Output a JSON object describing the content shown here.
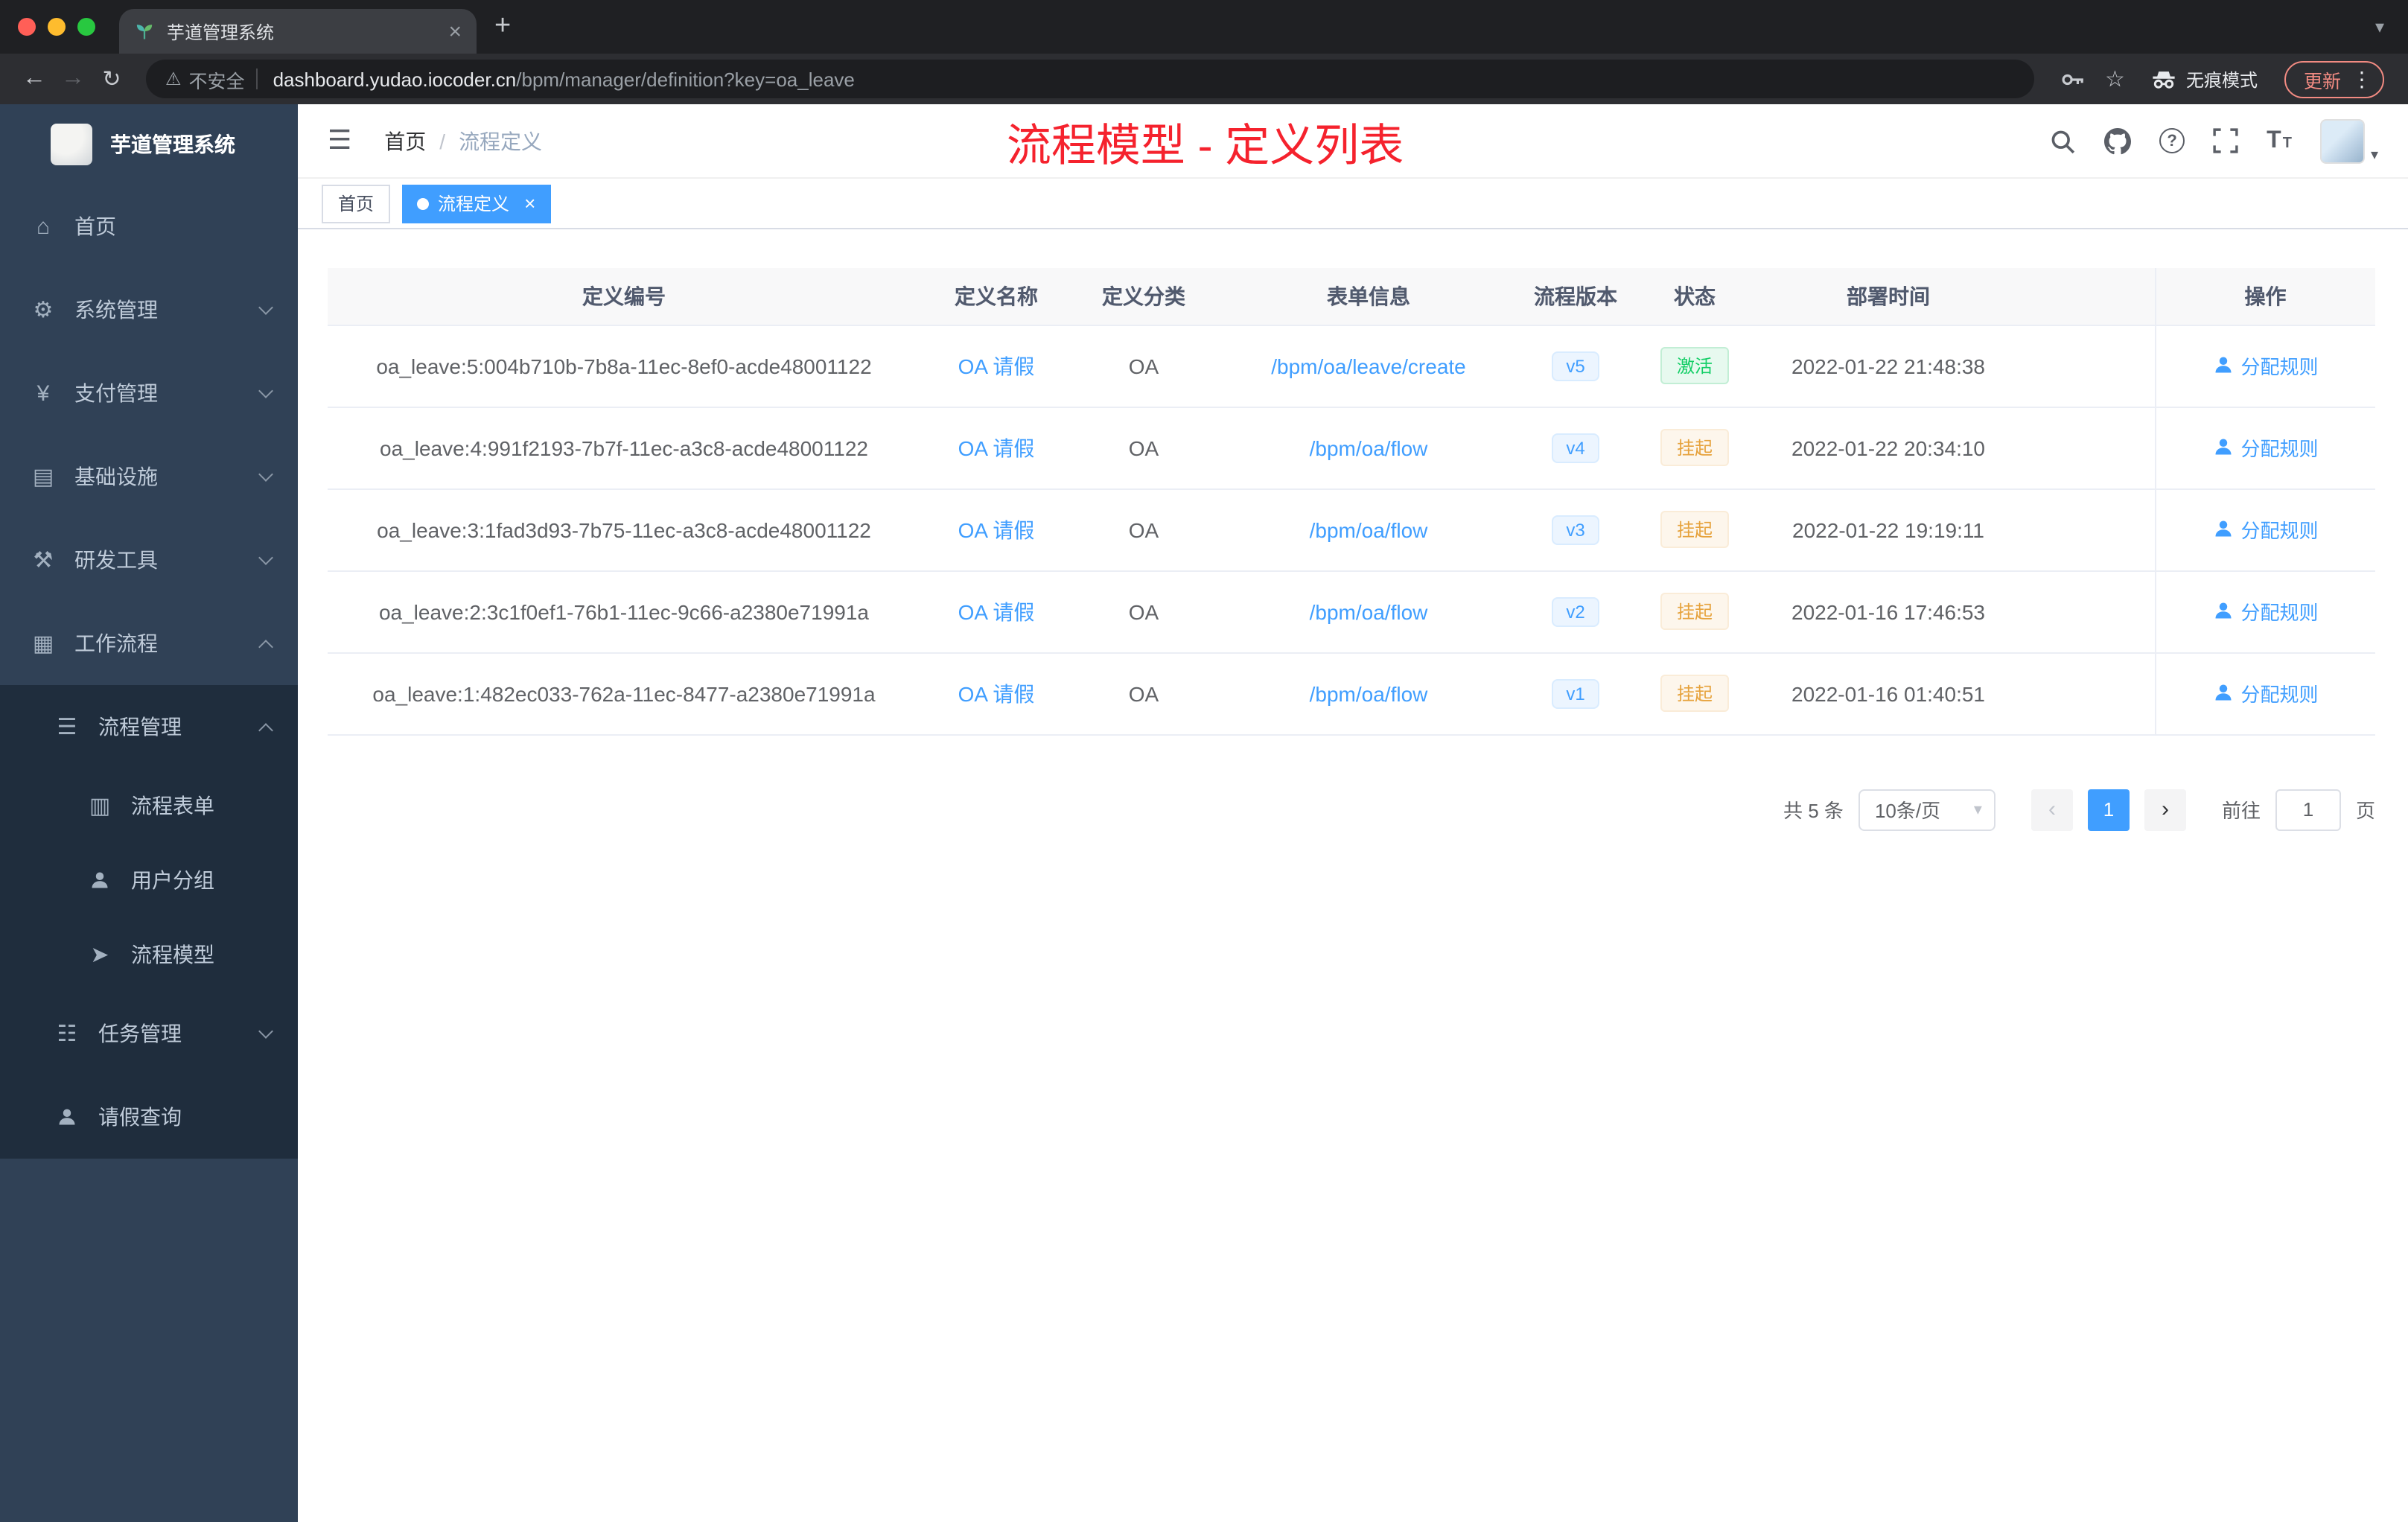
{
  "icons": {
    "close_tab": "×",
    "new_tab": "+",
    "tabs_caret": "▾",
    "back": "←",
    "forward": "→",
    "reload": "↻",
    "warning": "⚠",
    "star": "☆",
    "menu_dots": "⋮",
    "hamburger": "☰",
    "home": "⌂",
    "gear": "⚙",
    "yen": "¥",
    "infra": "▤",
    "tools": "⚒",
    "workflow": "▦",
    "process_mgmt": "☰",
    "form": "▥",
    "send": "➤",
    "task": "☷",
    "question": "?",
    "text_size_big": "T",
    "text_size_small": "T",
    "select_caret": "▾",
    "prev": "‹",
    "next": "›",
    "avatar_caret": "▾"
  },
  "browser": {
    "tab_title": "芋道管理系统",
    "security_label": "不安全",
    "url_host": "dashboard.yudao.iocoder.cn",
    "url_path": "/bpm/manager/definition?key=oa_leave",
    "incognito_label": "无痕模式",
    "update_label": "更新"
  },
  "sidebar": {
    "logo_title": "芋道管理系统",
    "items": [
      {
        "label": "首页"
      },
      {
        "label": "系统管理"
      },
      {
        "label": "支付管理"
      },
      {
        "label": "基础设施"
      },
      {
        "label": "研发工具"
      },
      {
        "label": "工作流程"
      },
      {
        "label": "流程管理"
      },
      {
        "label": "流程表单"
      },
      {
        "label": "用户分组"
      },
      {
        "label": "流程模型"
      },
      {
        "label": "任务管理"
      },
      {
        "label": "请假查询"
      }
    ]
  },
  "header": {
    "breadcrumb_home": "首页",
    "breadcrumb_sep": "/",
    "breadcrumb_current": "流程定义",
    "annotation": "流程模型 - 定义列表"
  },
  "tags": {
    "home": "首页",
    "active": "流程定义"
  },
  "table": {
    "columns": {
      "id": "定义编号",
      "name": "定义名称",
      "category": "定义分类",
      "form": "表单信息",
      "version": "流程版本",
      "status": "状态",
      "deploy_time": "部署时间",
      "action": "操作"
    },
    "rows": [
      {
        "id": "oa_leave:5:004b710b-7b8a-11ec-8ef0-acde48001122",
        "name": "OA 请假",
        "category": "OA",
        "form": "/bpm/oa/leave/create",
        "version": "v5",
        "status": "激活",
        "status_type": "success",
        "deploy_time": "2022-01-22 21:48:38",
        "action": "分配规则"
      },
      {
        "id": "oa_leave:4:991f2193-7b7f-11ec-a3c8-acde48001122",
        "name": "OA 请假",
        "category": "OA",
        "form": "/bpm/oa/flow",
        "version": "v4",
        "status": "挂起",
        "status_type": "warning",
        "deploy_time": "2022-01-22 20:34:10",
        "action": "分配规则"
      },
      {
        "id": "oa_leave:3:1fad3d93-7b75-11ec-a3c8-acde48001122",
        "name": "OA 请假",
        "category": "OA",
        "form": "/bpm/oa/flow",
        "version": "v3",
        "status": "挂起",
        "status_type": "warning",
        "deploy_time": "2022-01-22 19:19:11",
        "action": "分配规则"
      },
      {
        "id": "oa_leave:2:3c1f0ef1-76b1-11ec-9c66-a2380e71991a",
        "name": "OA 请假",
        "category": "OA",
        "form": "/bpm/oa/flow",
        "version": "v2",
        "status": "挂起",
        "status_type": "warning",
        "deploy_time": "2022-01-16 17:46:53",
        "action": "分配规则"
      },
      {
        "id": "oa_leave:1:482ec033-762a-11ec-8477-a2380e71991a",
        "name": "OA 请假",
        "category": "OA",
        "form": "/bpm/oa/flow",
        "version": "v1",
        "status": "挂起",
        "status_type": "warning",
        "deploy_time": "2022-01-16 01:40:51",
        "action": "分配规则"
      }
    ]
  },
  "pagination": {
    "total": "共 5 条",
    "page_size": "10条/页",
    "current_page": "1",
    "goto_label": "前往",
    "goto_value": "1",
    "goto_unit": "页"
  },
  "colors": {
    "accent": "#409eff",
    "success": "#13ce66",
    "warning": "#e6a23c",
    "annotation_red": "#f5222d",
    "sidebar_bg": "#304156",
    "sidebar_sub_bg": "#1f2d3d"
  }
}
